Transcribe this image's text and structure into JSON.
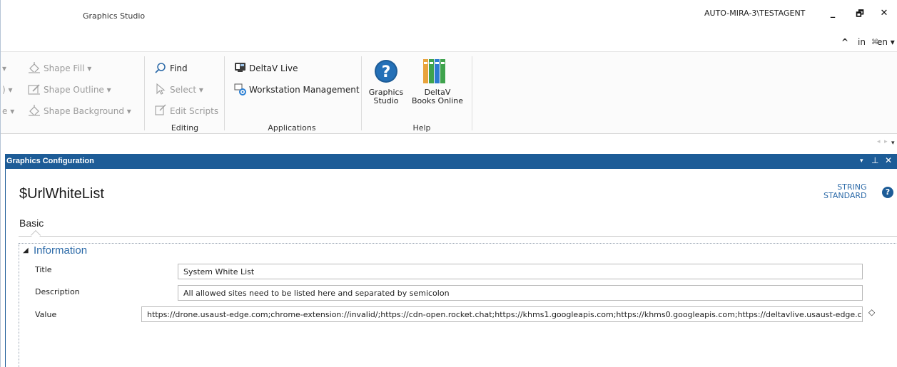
{
  "titlebar": {
    "app_title": "Graphics Studio",
    "user": "AUTO-MIRA-3\\TESTAGENT",
    "minimize": "_",
    "restore": "🗗",
    "close": "✕"
  },
  "subbar": {
    "collapse": "^",
    "in": "in",
    "symbol": "⌘",
    "lang": "en ▾"
  },
  "ribbon": {
    "shape_fill": "Shape Fill ▾",
    "shape_outline": "Shape Outline ▾",
    "shape_background": "Shape Background ▾",
    "find": "Find",
    "select": "Select ▾",
    "edit_scripts": "Edit Scripts",
    "editing_group": "Editing",
    "deltav_live": "DeltaV Live",
    "workstation_management": "Workstation Management",
    "applications_group": "Applications",
    "graphics_studio_line1": "Graphics",
    "graphics_studio_line2": "Studio",
    "books_line1": "DeltaV",
    "books_line2": "Books Online",
    "help_group": "Help"
  },
  "panel": {
    "title": "Graphics Configuration",
    "pin": "▾ ⊥ ✕",
    "variable_name": "$UrlWhiteList",
    "type_line1": "STRING",
    "type_line2": "STANDARD",
    "help": "?",
    "tab": "Basic"
  },
  "section": {
    "toggle": "◢",
    "title": "Information",
    "properties": [
      {
        "label": "Title",
        "value": "System White List"
      },
      {
        "label": "Description",
        "value": "All allowed sites need to be listed here and separated by semicolon"
      },
      {
        "label": "Value",
        "value": "https://drone.usaust-edge.com;chrome-extension://invalid/;https://cdn-open.rocket.chat;https://khms1.googleapis.com;https://khms0.googleapis.com;https://deltavlive.usaust-edge.com"
      }
    ],
    "value_marker": "◇"
  },
  "colors": {
    "panel_header": "#1d5c97",
    "accent_text": "#2c6aa8"
  }
}
